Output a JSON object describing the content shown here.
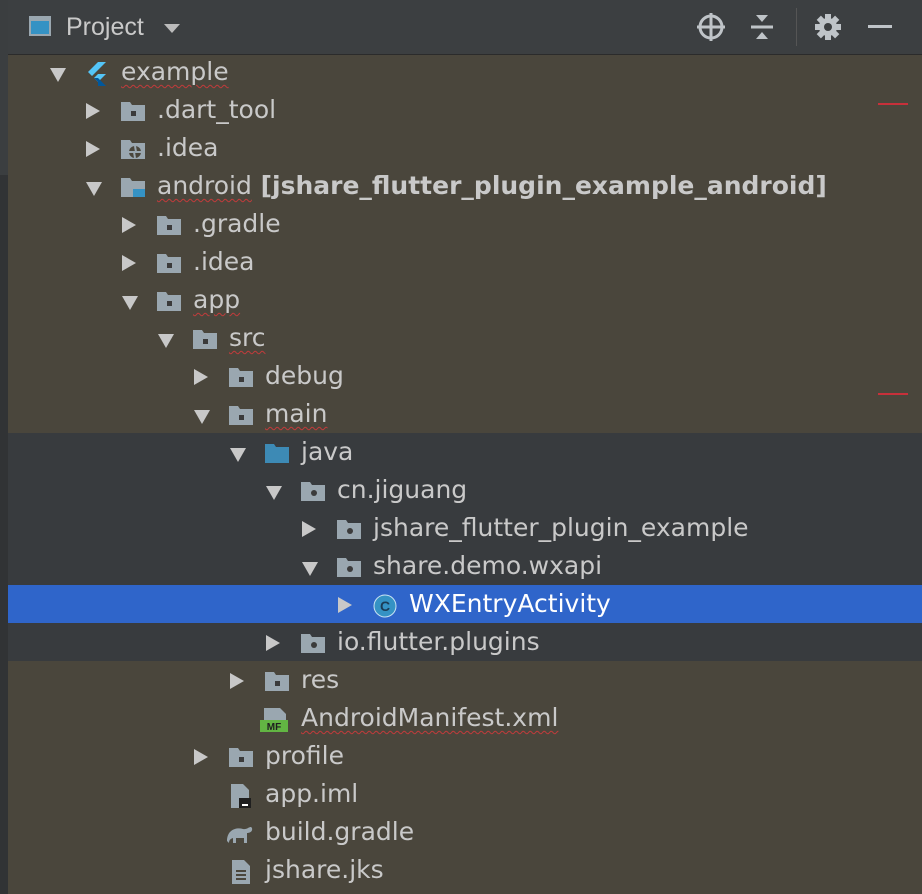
{
  "toolbar": {
    "title": "Project",
    "buttons": [
      {
        "name": "locate-icon"
      },
      {
        "name": "collapse-all-icon"
      },
      {
        "name": "gear-icon"
      },
      {
        "name": "hide-icon"
      }
    ]
  },
  "tree": [
    {
      "label": "example",
      "level": 0,
      "expanded": true,
      "icon": "flutter-icon",
      "squiggle": true
    },
    {
      "label": ".dart_tool",
      "level": 1,
      "expanded": false,
      "icon": "folder-icon"
    },
    {
      "label": ".idea",
      "level": 1,
      "expanded": false,
      "icon": "idea-folder-icon"
    },
    {
      "label": "android",
      "suffix": " [jshare_flutter_plugin_example_android]",
      "level": 1,
      "expanded": true,
      "icon": "android-module-folder-icon",
      "squiggle": true
    },
    {
      "label": ".gradle",
      "level": 2,
      "expanded": false,
      "icon": "folder-icon"
    },
    {
      "label": ".idea",
      "level": 2,
      "expanded": false,
      "icon": "folder-icon"
    },
    {
      "label": "app",
      "level": 2,
      "expanded": true,
      "icon": "folder-icon",
      "squiggle": true
    },
    {
      "label": "src",
      "level": 3,
      "expanded": true,
      "icon": "folder-icon",
      "squiggle": true
    },
    {
      "label": "debug",
      "level": 4,
      "expanded": false,
      "icon": "folder-icon"
    },
    {
      "label": "main",
      "level": 4,
      "expanded": true,
      "icon": "folder-icon",
      "squiggle": true
    },
    {
      "label": "java",
      "level": 5,
      "expanded": true,
      "icon": "source-folder-icon",
      "dark": true
    },
    {
      "label": "cn.jiguang",
      "level": 6,
      "expanded": true,
      "icon": "package-icon",
      "dark": true
    },
    {
      "label": "jshare_flutter_plugin_example",
      "level": 7,
      "expanded": false,
      "icon": "package-icon",
      "dark": true
    },
    {
      "label": "share.demo.wxapi",
      "level": 7,
      "expanded": true,
      "icon": "package-icon",
      "dark": true
    },
    {
      "label": "WXEntryActivity",
      "level": 8,
      "expanded": false,
      "icon": "class-icon",
      "selected": true
    },
    {
      "label": "io.flutter.plugins",
      "level": 6,
      "expanded": false,
      "icon": "package-icon",
      "dark": true
    },
    {
      "label": "res",
      "level": 5,
      "expanded": false,
      "icon": "folder-icon"
    },
    {
      "label": "AndroidManifest.xml",
      "level": 5,
      "leaf": true,
      "icon": "manifest-icon",
      "squiggle": true
    },
    {
      "label": "profile",
      "level": 4,
      "expanded": false,
      "icon": "folder-icon"
    },
    {
      "label": "app.iml",
      "level": 4,
      "leaf": true,
      "icon": "iml-file-icon"
    },
    {
      "label": "build.gradle",
      "level": 4,
      "leaf": true,
      "icon": "gradle-icon"
    },
    {
      "label": "jshare.jks",
      "level": 4,
      "leaf": true,
      "icon": "text-file-icon"
    }
  ],
  "icon_labels": {
    "manifest": "MF",
    "class": "C"
  },
  "colors": {
    "background": "#4a463c",
    "dark_band": "#383b3e",
    "selection": "#2f65ca",
    "toolbar": "#3c3f41",
    "folder": "#9aa7b0",
    "source_folder": "#3d8ab5",
    "class_circle": "#3592c4",
    "squiggle": "#c23b3b",
    "error_stripe": "#c7303a"
  }
}
